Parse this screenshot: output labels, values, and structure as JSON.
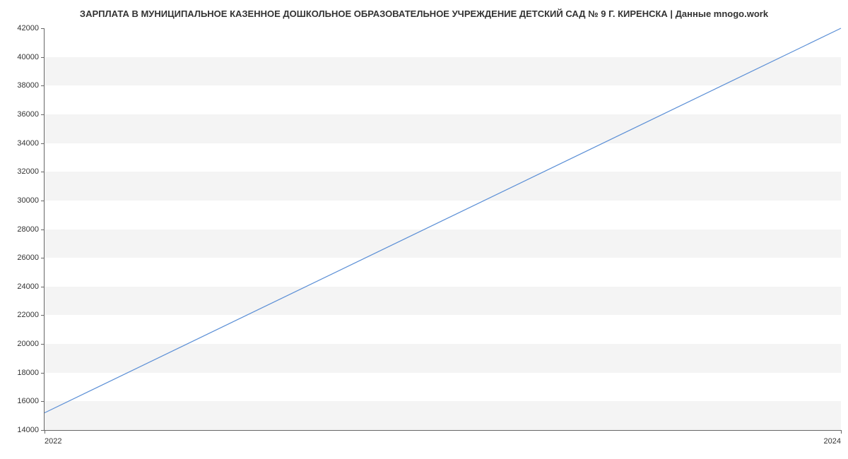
{
  "chart_data": {
    "type": "line",
    "title": "ЗАРПЛАТА В МУНИЦИПАЛЬНОЕ КАЗЕННОЕ ДОШКОЛЬНОЕ ОБРАЗОВАТЕЛЬНОЕ УЧРЕЖДЕНИЕ ДЕТСКИЙ САД № 9 Г. КИРЕНСКА | Данные mnogo.work",
    "x": [
      2022,
      2024
    ],
    "values": [
      15200,
      42000
    ],
    "xlabel": "",
    "ylabel": "",
    "xlim": [
      2022,
      2024
    ],
    "ylim": [
      14000,
      42000
    ],
    "x_ticks": [
      2022,
      2024
    ],
    "y_ticks": [
      14000,
      16000,
      18000,
      20000,
      22000,
      24000,
      26000,
      28000,
      30000,
      32000,
      34000,
      36000,
      38000,
      40000,
      42000
    ],
    "grid": true
  }
}
